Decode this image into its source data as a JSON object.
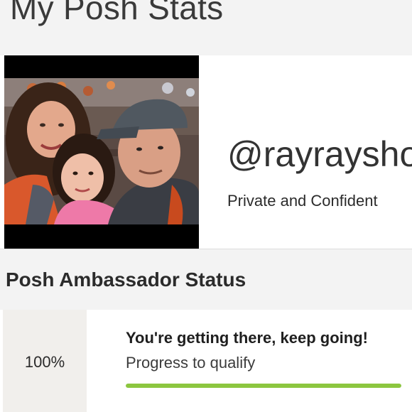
{
  "page": {
    "title": "My Posh Stats"
  },
  "profile": {
    "username": "@rayraysho",
    "privacy_note": "Private and Confident",
    "photo_description": "family photo"
  },
  "ambassador": {
    "heading": "Posh Ambassador Status",
    "percent_label": "100%",
    "message": "You're getting there, keep going!",
    "progress_label": "Progress to qualify",
    "progress_fraction": 1.0
  },
  "colors": {
    "background": "#f3f3f3",
    "card": "#ffffff",
    "percent_box": "#f1efec",
    "progress_fill": "#8cc63f",
    "progress_track": "#e4e4e4"
  }
}
